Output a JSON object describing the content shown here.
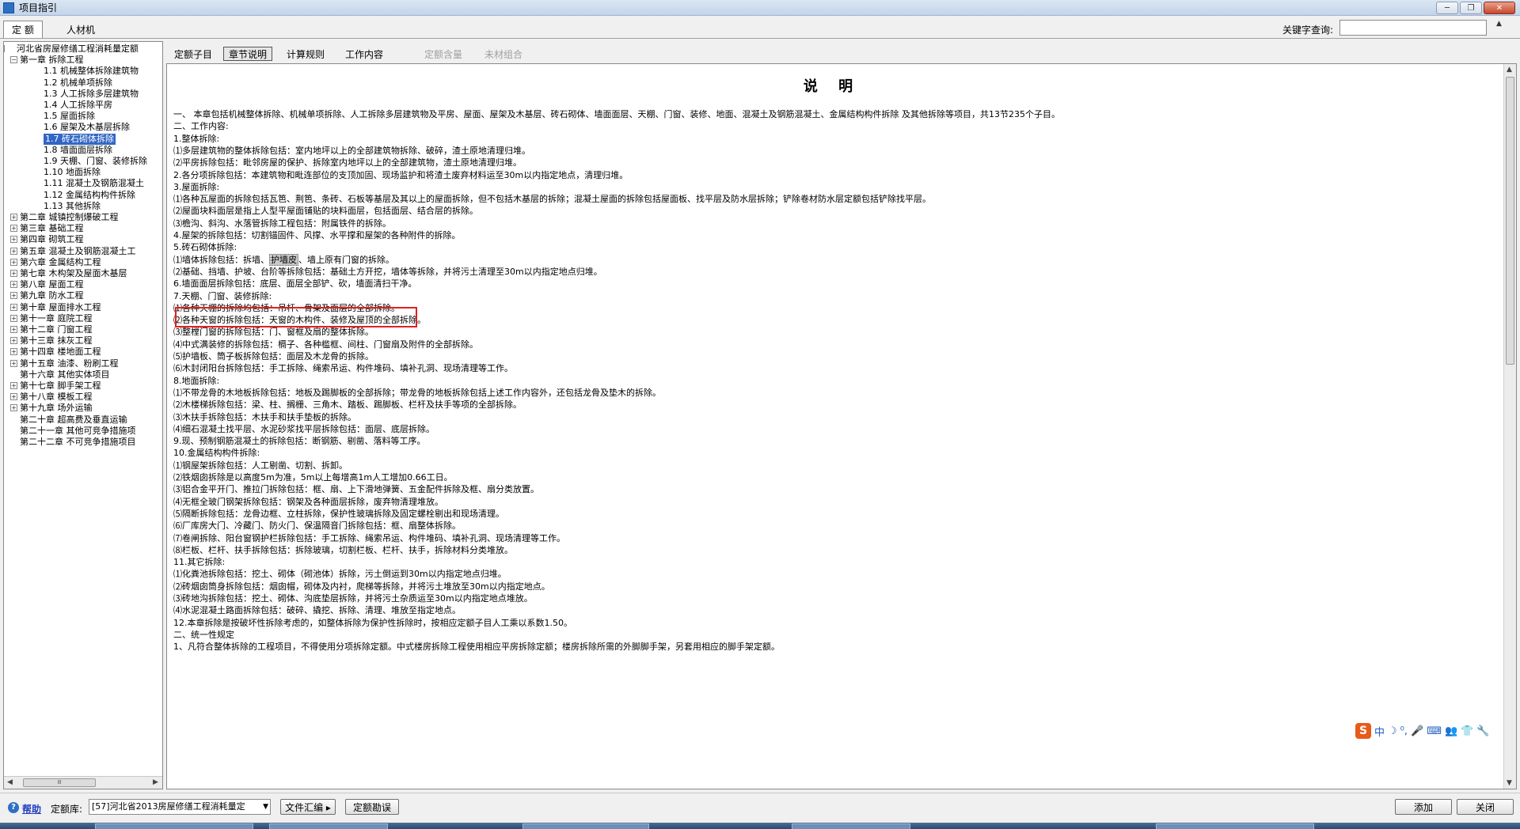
{
  "window": {
    "title": "项目指引",
    "controls": {
      "minimize": "─",
      "maximize": "❐",
      "close": "✕"
    }
  },
  "main_tabs": [
    {
      "label": "定  额"
    },
    {
      "label": "人材机"
    }
  ],
  "keyword_search": {
    "label": "关键字查询:",
    "value": "",
    "scroll_arrow": "▲"
  },
  "tree": {
    "nodes": [
      {
        "label": "河北省房屋修缮工程消耗量定额",
        "level": 0,
        "expander": "−"
      },
      {
        "label": "第一章 拆除工程",
        "level": 1,
        "expander": "−"
      },
      {
        "label": "1.1 机械整体拆除建筑物",
        "level": 2
      },
      {
        "label": "1.2 机械单项拆除",
        "level": 2
      },
      {
        "label": "1.3 人工拆除多层建筑物",
        "level": 2
      },
      {
        "label": "1.4 人工拆除平房",
        "level": 2
      },
      {
        "label": "1.5 屋面拆除",
        "level": 2
      },
      {
        "label": "1.6 屋架及木基层拆除",
        "level": 2
      },
      {
        "label": "1.7 砖石砌体拆除",
        "level": 2,
        "selected": true
      },
      {
        "label": "1.8 墙面面层拆除",
        "level": 2
      },
      {
        "label": "1.9 天棚、门窗、装修拆除",
        "level": 2
      },
      {
        "label": "1.10 地面拆除",
        "level": 2
      },
      {
        "label": "1.11 混凝土及钢筋混凝土",
        "level": 2
      },
      {
        "label": "1.12 金属结构构件拆除",
        "level": 2
      },
      {
        "label": "1.13 其他拆除",
        "level": 2
      },
      {
        "label": "第二章 城镇控制爆破工程",
        "level": 1,
        "expander": "+"
      },
      {
        "label": "第三章 基础工程",
        "level": 1,
        "expander": "+"
      },
      {
        "label": "第四章 砌筑工程",
        "level": 1,
        "expander": "+"
      },
      {
        "label": "第五章 混凝土及钢筋混凝土工",
        "level": 1,
        "expander": "+"
      },
      {
        "label": "第六章 金属结构工程",
        "level": 1,
        "expander": "+"
      },
      {
        "label": "第七章 木构架及屋面木基层",
        "level": 1,
        "expander": "+"
      },
      {
        "label": "第八章 屋面工程",
        "level": 1,
        "expander": "+"
      },
      {
        "label": "第九章 防水工程",
        "level": 1,
        "expander": "+"
      },
      {
        "label": "第十章 屋面排水工程",
        "level": 1,
        "expander": "+"
      },
      {
        "label": "第十一章 庭院工程",
        "level": 1,
        "expander": "+"
      },
      {
        "label": "第十二章 门窗工程",
        "level": 1,
        "expander": "+"
      },
      {
        "label": "第十三章 抹灰工程",
        "level": 1,
        "expander": "+"
      },
      {
        "label": "第十四章 楼地面工程",
        "level": 1,
        "expander": "+"
      },
      {
        "label": "第十五章 油漆、粉刷工程",
        "level": 1,
        "expander": "+"
      },
      {
        "label": "第十六章 其他实体项目",
        "level": 1
      },
      {
        "label": "第十七章 脚手架工程",
        "level": 1,
        "expander": "+"
      },
      {
        "label": "第十八章 模板工程",
        "level": 1,
        "expander": "+"
      },
      {
        "label": "第十九章 场外运输",
        "level": 1,
        "expander": "+"
      },
      {
        "label": "第二十章 超高费及垂直运输",
        "level": 1
      },
      {
        "label": "第二十一章 其他可竞争措施项",
        "level": 1
      },
      {
        "label": "第二十二章 不可竞争措施项目",
        "level": 1
      }
    ],
    "hscroll": {
      "left": "◀",
      "thumb": "Ⅲ",
      "right": "▶"
    }
  },
  "sub_tabs": [
    {
      "label": "定额子目",
      "state": "normal"
    },
    {
      "label": "章节说明",
      "state": "active"
    },
    {
      "label": "计算规则",
      "state": "normal"
    },
    {
      "label": "工作内容",
      "state": "normal"
    },
    {
      "label": "定额含量",
      "state": "disabled"
    },
    {
      "label": "未材组合",
      "state": "disabled"
    }
  ],
  "document": {
    "title": "说 明",
    "lines": [
      "一、 本章包括机械整体拆除、机械单项拆除、人工拆除多层建筑物及平房、屋面、屋架及木基层、砖石砌体、墙面面层、天棚、门窗、装修、地面、混凝土及钢筋混凝土、金属结构构件拆除 及其他拆除等项目，共13节235个子目。",
      "二、工作内容:",
      "1.整体拆除:",
      "⑴多层建筑物的整体拆除包括：室内地坪以上的全部建筑物拆除、破碎，渣土原地清理归堆。",
      "⑵平房拆除包括：毗邻房屋的保护、拆除室内地坪以上的全部建筑物，渣土原地清理归堆。",
      "2.各分项拆除包括：本建筑物和毗连部位的支顶加固、现场监护和将渣土废弃材料运至30m以内指定地点，清理归堆。",
      "3.屋面拆除:",
      "⑴各种瓦屋面的拆除包括瓦笆、荆笆、条砖、石板等基层及其以上的屋面拆除，但不包括木基层的拆除；混凝土屋面的拆除包括屋面板、找平层及防水层拆除；铲除卷材防水层定额包括铲除找平层。",
      "⑵屋面块料面层是指上人型平屋面铺贴的块料面层，包括面层、结合层的拆除。",
      "⑶檐沟、斜沟、水落管拆除工程包括：附属铁件的拆除。",
      "4.屋架的拆除包括：切割锚固件、风撑、水平撑和屋架的各种附件的拆除。",
      "5.砖石砌体拆除:",
      {
        "pre": "⑴墙体拆除包括：拆墙、",
        "hl": "护墙皮",
        "post": "、墙上原有门窗的拆除。"
      },
      "⑵基础、挡墙、护坡、台阶等拆除包括：基础土方开挖，墙体等拆除，并将污土清理至30m以内指定地点归堆。",
      "6.墙面面层拆除包括：底层、面层全部铲、砍，墙面清扫干净。",
      "7.天棚、门窗、装修拆除:",
      "⑴各种天棚的拆除均包括：吊杆、骨架及面层的全部拆除。",
      "⑵各种天窗的拆除包括：天窗的木构件、装修及屋顶的全部拆除。",
      "⑶整樘门窗的拆除包括：门、窗框及扇的整体拆除。",
      "⑷中式满装修的拆除包括：槅子、各种槛框、间柱、门窗扇及附件的全部拆除。",
      "⑸护墙板、筒子板拆除包括：面层及木龙骨的拆除。",
      "⑹木封闭阳台拆除包括：手工拆除、绳索吊运、构件堆码、填补孔洞、现场清理等工作。",
      "8.地面拆除:",
      "⑴不带龙骨的木地板拆除包括：地板及踢脚板的全部拆除；带龙骨的地板拆除包括上述工作内容外，还包括龙骨及垫木的拆除。",
      "⑵木楼梯拆除包括：梁、柱、搁栅、三角木、踏板、踢脚板、栏杆及扶手等项的全部拆除。",
      "⑶木扶手拆除包括：木扶手和扶手垫板的拆除。",
      "⑷细石混凝土找平层、水泥砂浆找平层拆除包括：面层、底层拆除。",
      "9.现、预制钢筋混凝土的拆除包括：断钢筋、剔凿、落料等工序。",
      "10.金属结构构件拆除:",
      "⑴钢屋架拆除包括：人工剔凿、切割、拆卸。",
      "⑵铁烟囱拆除是以高度5m为准，5m以上每增高1m人工增加0.66工日。",
      "⑶铝合金平开门、推拉门拆除包括：框、扇、上下滑地弹簧、五金配件拆除及框、扇分类放置。",
      "⑷无框全玻门钢架拆除包括：钢架及各种面层拆除，废弃物清理堆放。",
      "⑸隔断拆除包括：龙骨边框、立柱拆除，保护性玻璃拆除及固定螺栓剔出和现场清理。",
      "⑹厂库房大门、冷藏门、防火门、保温隔音门拆除包括：框、扇整体拆除。",
      "⑺卷闸拆除、阳台窗钢护栏拆除包括：手工拆除、绳索吊运、构件堆码、填补孔洞、现场清理等工作。",
      "⑻栏板、栏杆、扶手拆除包括：拆除玻璃，切割栏板、栏杆、扶手，拆除材料分类堆放。",
      "11.其它拆除:",
      "⑴化粪池拆除包括：挖土、砌体（砌池体）拆除，污土倒运到30m以内指定地点归堆。",
      "⑵砖烟囱筒身拆除包括：烟囱帽，砌体及内衬，爬梯等拆除，并将污土堆放至30m以内指定地点。",
      "⑶砖地沟拆除包括：挖土、砌体、沟底垫层拆除，并将污土杂质运至30m以内指定地点堆放。",
      "⑷水泥混凝土路面拆除包括：破碎、撬挖、拆除、清理、堆放至指定地点。",
      "12.本章拆除是按破坏性拆除考虑的，如整体拆除为保护性拆除时，按相应定额子目人工乘以系数1.50。",
      "二、统一性规定",
      "1、凡符合整体拆除的工程项目，不得使用分项拆除定额。中式楼房拆除工程使用相应平房拆除定额；楼房拆除所需的外脚脚手架，另套用相应的脚手架定额。"
    ]
  },
  "doc_scroll": {
    "up": "▲",
    "down": "▼"
  },
  "ime": {
    "logo": "S",
    "items": [
      "中",
      "☽",
      "⁰,",
      "🎤",
      "⌨",
      "👥",
      "👕",
      "🔧"
    ]
  },
  "bottom": {
    "help_icon_glyph": "?",
    "help": "帮助",
    "lib_label": "定额库:",
    "lib_value": "[57]河北省2013房屋修缮工程消耗量定",
    "lib_caret": "▼",
    "file_button": "文件汇编 ▸",
    "check_button": "定额勘误",
    "add_button": "添加",
    "close_button": "关闭"
  },
  "colors": {
    "selection": "#3166c5",
    "highlight_border": "#e02020",
    "link": "#1f3fbf"
  }
}
